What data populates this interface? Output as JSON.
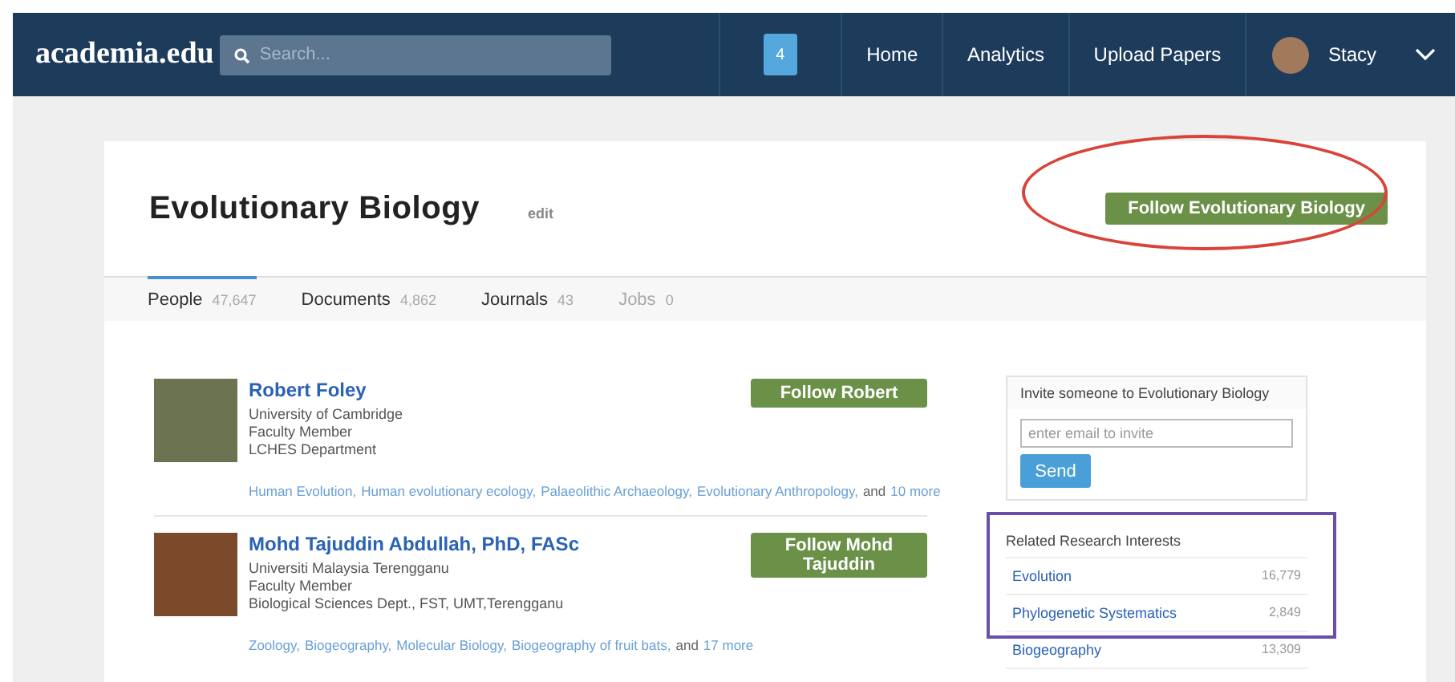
{
  "nav": {
    "logo": "academia.edu",
    "search": {
      "placeholder": "Search..."
    },
    "notifications": "4",
    "links": [
      {
        "label": "Home"
      },
      {
        "label": "Analytics"
      },
      {
        "label": "Upload Papers"
      }
    ],
    "user": "Stacy"
  },
  "topic": {
    "title": "Evolutionary Biology",
    "edit": "edit",
    "follow_button": "Follow Evolutionary Biology"
  },
  "tabs": [
    {
      "label": "People",
      "count": "47,647",
      "selected": true,
      "disabled": false
    },
    {
      "label": "Documents",
      "count": "4,862",
      "selected": false,
      "disabled": false
    },
    {
      "label": "Journals",
      "count": "43",
      "selected": false,
      "disabled": false
    },
    {
      "label": "Jobs",
      "count": "0",
      "selected": false,
      "disabled": true
    }
  ],
  "people": [
    {
      "name": "Robert Foley",
      "affiliation": "University of Cambridge",
      "role": "Faculty Member",
      "department": "LCHES Department",
      "follow_button": "Follow Robert",
      "interests": [
        "Human Evolution,",
        "Human evolutionary ecology,",
        "Palaeolithic Archaeology,",
        "Evolutionary Anthropology,"
      ],
      "and_text": "and",
      "more_link": "10 more"
    },
    {
      "name": "Mohd Tajuddin Abdullah, PhD, FASc",
      "affiliation": "Universiti Malaysia Terengganu",
      "role": "Faculty Member",
      "department": "Biological Sciences Dept., FST, UMT,Terengganu",
      "follow_button": "Follow Mohd Tajuddin",
      "interests": [
        "Zoology,",
        "Biogeography,",
        "Molecular Biology,",
        "Biogeography of fruit bats,"
      ],
      "and_text": "and",
      "more_link": "17 more"
    }
  ],
  "invite": {
    "title": "Invite someone to Evolutionary Biology",
    "placeholder": "enter email to invite",
    "button": "Send"
  },
  "related": {
    "title": "Related Research Interests",
    "items": [
      {
        "name": "Evolution",
        "count": "16,779"
      },
      {
        "name": "Phylogenetic Systematics",
        "count": "2,849"
      },
      {
        "name": "Biogeography",
        "count": "13,309"
      }
    ]
  }
}
